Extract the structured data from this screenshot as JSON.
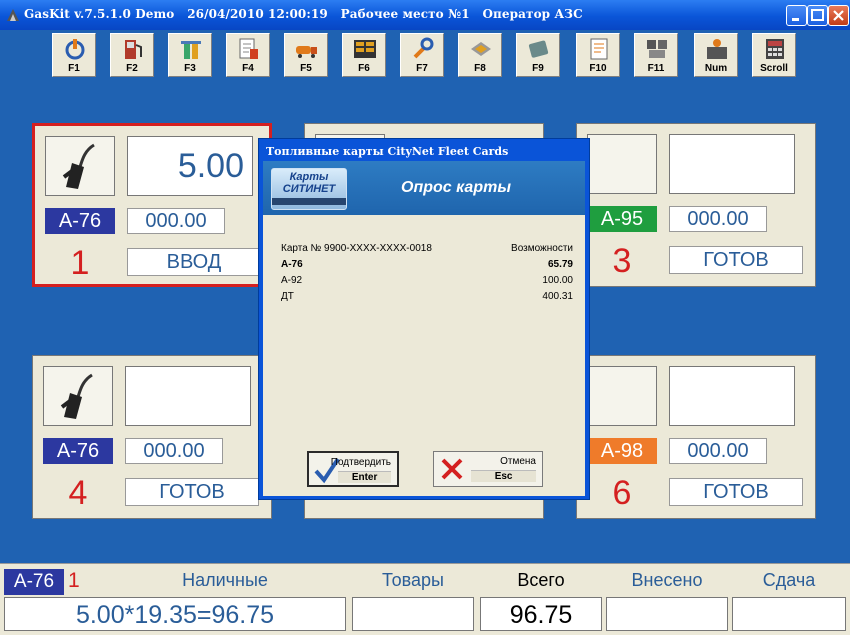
{
  "window": {
    "title": "GasKit v.7.5.1.0 Demo   26/04/2010 12:00:19   Рабочее место №1   Оператор АЗС"
  },
  "toolbar": {
    "buttons": [
      {
        "label": "F1",
        "icon": "power-refresh-icon"
      },
      {
        "label": "F2",
        "icon": "fuel-pump-icon"
      },
      {
        "label": "F3",
        "icon": "pump-station-icon"
      },
      {
        "label": "F4",
        "icon": "document-fuel-icon"
      },
      {
        "label": "F5",
        "icon": "tanker-truck-icon"
      },
      {
        "label": "F6",
        "icon": "counters-icon"
      },
      {
        "label": "F7",
        "icon": "wrench-settings-icon"
      },
      {
        "label": "F8",
        "icon": "cash-register-icon"
      },
      {
        "label": "F9",
        "icon": "card-icon"
      },
      {
        "label": "F10",
        "icon": "report-icon"
      },
      {
        "label": "F11",
        "icon": "printer-icon"
      },
      {
        "label": "Num",
        "icon": "operator-icon"
      },
      {
        "label": "Scroll",
        "icon": "calculator-icon"
      }
    ]
  },
  "pumps": [
    {
      "number": "1",
      "fuel": "А-76",
      "display": "5.00",
      "volume": "000.00",
      "status": "ВВОД",
      "fuel_color": "#2c38a0",
      "active": true
    },
    {
      "number": "3",
      "fuel": "А-95",
      "display": "",
      "volume": "000.00",
      "status": "ГОТОВ",
      "fuel_color": "#1f9e3f"
    },
    {
      "number": "4",
      "fuel": "А-76",
      "display": "",
      "volume": "000.00",
      "status": "ГОТОВ",
      "fuel_color": "#2c38a0"
    },
    {
      "number": "6",
      "fuel": "А-98",
      "display": "",
      "volume": "000.00",
      "status": "ГОТОВ",
      "fuel_color": "#ef7b2a"
    }
  ],
  "dialog": {
    "title": "Топливные карты CityNet Fleet Cards",
    "logo_line1": "Карты",
    "logo_line2": "СИТИНЕТ",
    "heading": "Опрос карты",
    "card_label": "Карта № 9900-XXXX-XXXX-0018",
    "capabilities_label": "Возможности",
    "rows": [
      {
        "fuel": "А-76",
        "value": "65.79",
        "bold": true
      },
      {
        "fuel": "А-92",
        "value": "100.00"
      },
      {
        "fuel": "ДТ",
        "value": "400.31"
      }
    ],
    "confirm": {
      "label": "Подтвердить",
      "key": "Enter"
    },
    "cancel": {
      "label": "Отмена",
      "key": "Esc"
    }
  },
  "bottom": {
    "fuel": "А-76",
    "pump": "1",
    "headers": {
      "cash": "Наличные",
      "goods": "Товары",
      "total": "Всего",
      "paid": "Внесено",
      "change": "Сдача"
    },
    "values": {
      "cash": "5.00*19.35=96.75",
      "goods": "",
      "total": "96.75",
      "paid": "",
      "change": ""
    }
  }
}
